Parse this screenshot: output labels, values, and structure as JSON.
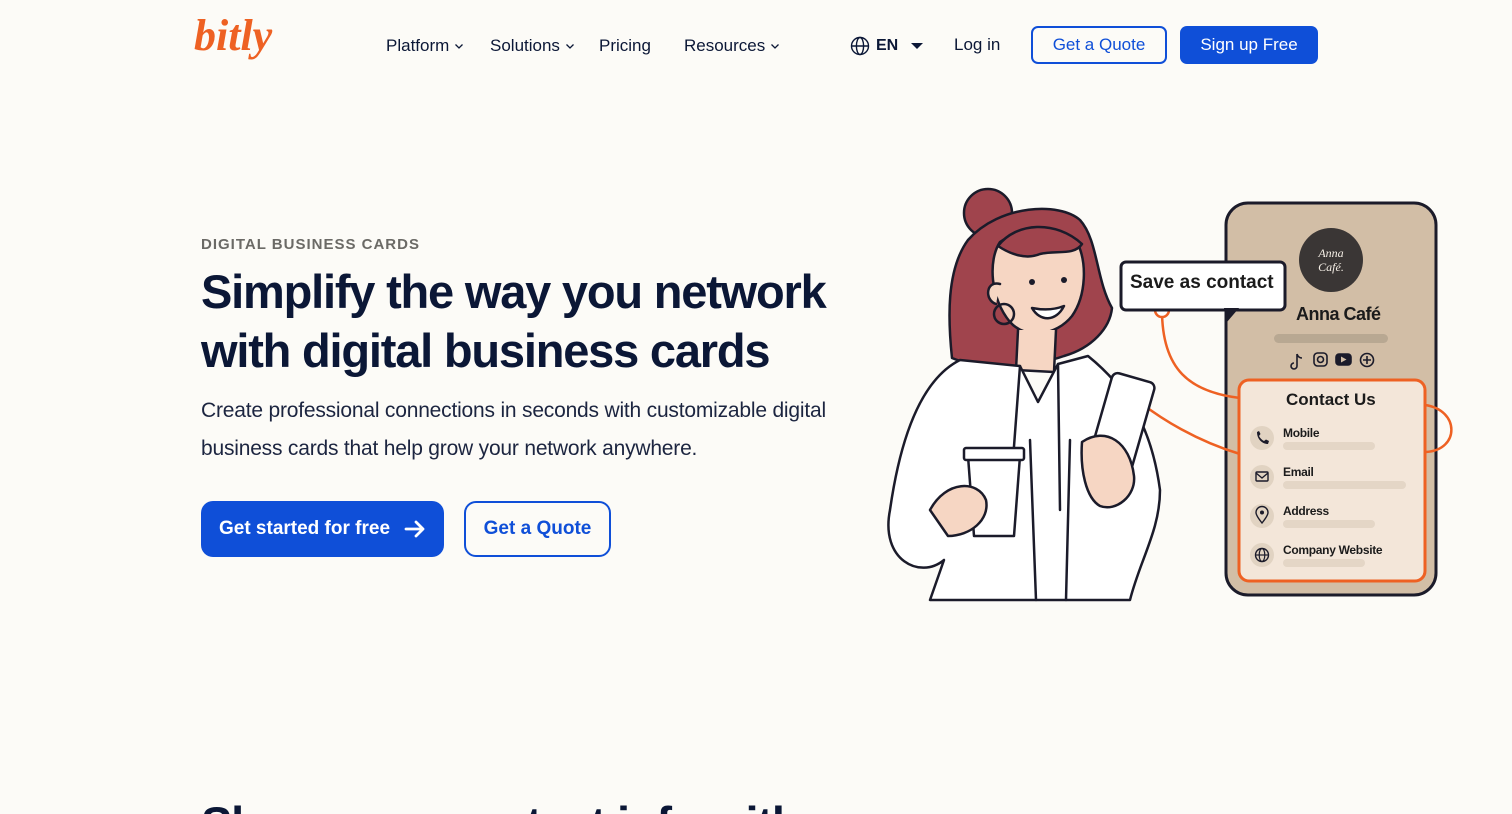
{
  "brand": {
    "logo_text": "bitly",
    "accent_orange": "#ee6123",
    "primary_blue": "#0f4fd8",
    "navy": "#0b1736"
  },
  "nav": {
    "items": [
      {
        "label": "Platform",
        "has_dropdown": true
      },
      {
        "label": "Solutions",
        "has_dropdown": true
      },
      {
        "label": "Pricing",
        "has_dropdown": false
      },
      {
        "label": "Resources",
        "has_dropdown": true
      }
    ],
    "language": "EN",
    "login": "Log in",
    "quote": "Get a Quote",
    "signup": "Sign up Free"
  },
  "hero": {
    "eyebrow": "DIGITAL BUSINESS CARDS",
    "title": "Simplify the way you network with digital business cards",
    "subtitle": "Create professional connections in seconds with customizable digital business cards that help grow your network anywhere.",
    "cta_primary": "Get started for free",
    "cta_secondary": "Get a Quote"
  },
  "illustration": {
    "bubble": "Save as contact",
    "avatar_text": "Anna Café",
    "card_name": "Anna Café",
    "social_icons": [
      "tiktok-icon",
      "instagram-icon",
      "youtube-icon",
      "add-icon"
    ],
    "contact_title": "Contact Us",
    "rows": [
      {
        "label": "Mobile",
        "icon": "phone-icon"
      },
      {
        "label": "Email",
        "icon": "mail-icon"
      },
      {
        "label": "Address",
        "icon": "location-icon"
      },
      {
        "label": "Company Website",
        "icon": "globe-icon"
      }
    ]
  },
  "next_section": {
    "title_partial": "Share your contact info with"
  }
}
